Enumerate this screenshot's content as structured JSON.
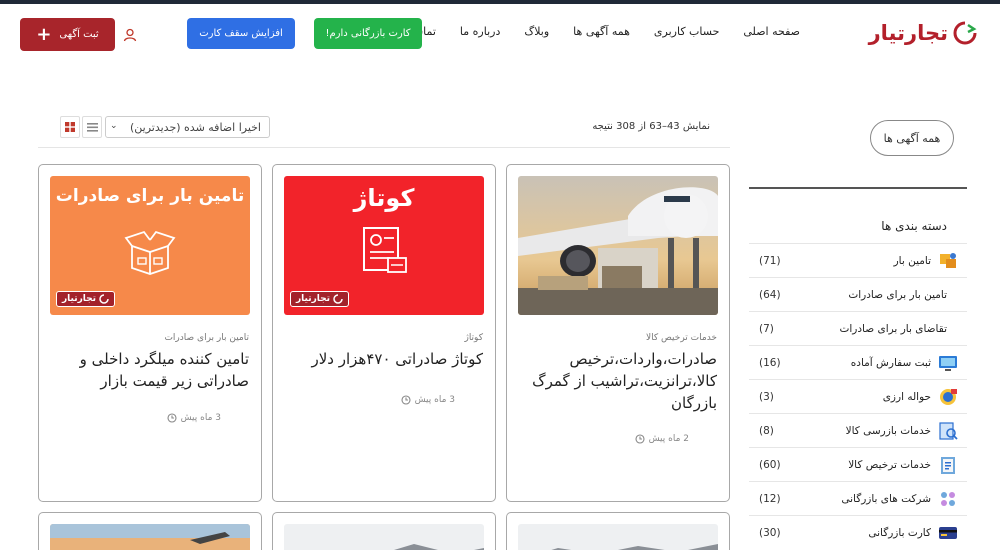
{
  "header": {
    "logo_text": "تجارتیار",
    "nav": [
      "صفحه اصلی",
      "حساب کاربری",
      "همه آگهی ها",
      "وبلاگ",
      "درباره ما",
      "تماس با ما"
    ],
    "btn_card": "کارت بازرگانی دارم!",
    "btn_limit": "افزایش سقف کارت",
    "btn_post": "ثبت آگهی",
    "colors": {
      "red": "#a8252b",
      "green": "#24b34b",
      "blue": "#2f6fe4"
    }
  },
  "toolbar": {
    "result_text": "نمایش 43–63 از 308 نتیجه",
    "sort_value": "اخیرا اضافه شده (جدیدترین)"
  },
  "cards": [
    {
      "category": "خدمات ترخیص کالا",
      "title": "صادرات،واردات،ترخیص کالا،ترانزیت،تراشیب از گمرگ بازرگان",
      "time": "2 ماه پیش",
      "thumb": "airplane-photo"
    },
    {
      "category": "کوتاژ",
      "title": "کوتاژ صادراتی ۴۷۰هزار دلار",
      "time": "3 ماه پیش",
      "thumb_heading": "کوتاژ",
      "thumb": "document-icon"
    },
    {
      "category": "تامین بار برای صادرات",
      "title": "تامین کننده میلگرد داخلی و صادراتی زیر قیمت بازار",
      "time": "3 ماه پیش",
      "thumb_heading": "تامین بار برای صادرات",
      "thumb": "open-box-icon"
    }
  ],
  "sidebar": {
    "all_ads": "همه آگهی ها",
    "title": "دسته بندی ها",
    "categories": [
      {
        "label": "تامین بار",
        "count": "(71)",
        "icon": "cargo-icon"
      },
      {
        "label": "تامین بار برای صادرات",
        "count": "(64)",
        "icon": ""
      },
      {
        "label": "تقاضای بار برای صادرات",
        "count": "(7)",
        "icon": ""
      },
      {
        "label": "ثبت سفارش آماده",
        "count": "(16)",
        "icon": "monitor-icon"
      },
      {
        "label": "حواله ارزی",
        "count": "(3)",
        "icon": "currency-icon"
      },
      {
        "label": "خدمات بازرسی کالا",
        "count": "(8)",
        "icon": "inspection-icon"
      },
      {
        "label": "خدمات ترخیص کالا",
        "count": "(60)",
        "icon": "clipboard-icon"
      },
      {
        "label": "شرکت های بازرگانی",
        "count": "(12)",
        "icon": "company-icon"
      },
      {
        "label": "کارت بازرگانی",
        "count": "(30)",
        "icon": "card-icon"
      }
    ]
  }
}
